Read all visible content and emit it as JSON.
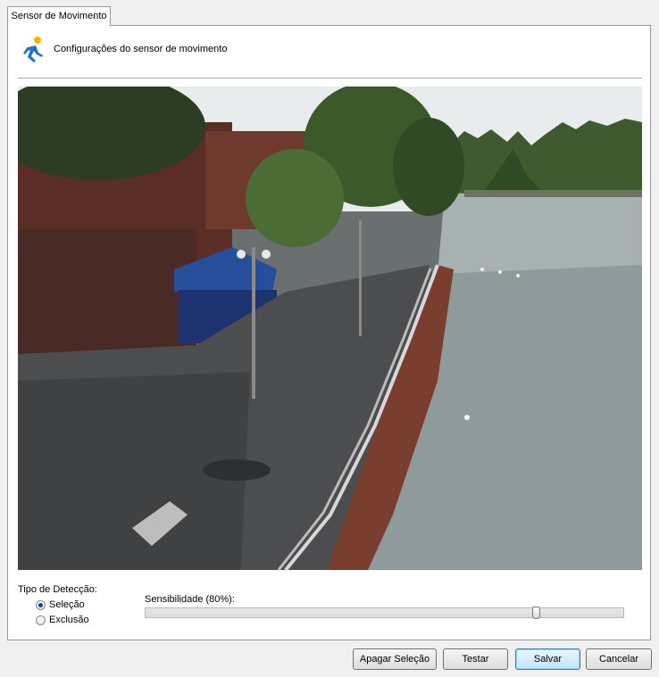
{
  "tab": {
    "label": "Sensor de Movimento"
  },
  "header": {
    "title": "Configurações do sensor de movimento",
    "icon": "running-person-icon"
  },
  "detection": {
    "label": "Tipo de Detecção:",
    "options": [
      {
        "label": "Seleção",
        "checked": true
      },
      {
        "label": "Exclusão",
        "checked": false
      }
    ]
  },
  "sensitivity": {
    "label": "Sensibilidade (80%):",
    "value_percent": 80
  },
  "buttons": {
    "clear": "Apagar Seleção",
    "test": "Testar",
    "save": "Salvar",
    "cancel": "Cancelar"
  },
  "colors": {
    "accent": "#1e6fd0",
    "default_button": "#3c7fb1"
  }
}
